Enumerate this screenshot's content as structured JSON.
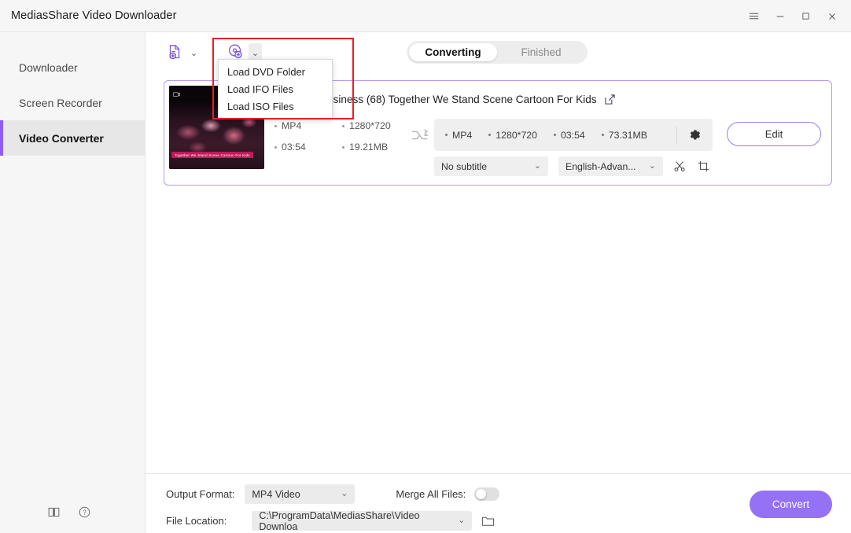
{
  "window": {
    "title": "MediasShare Video Downloader",
    "controls": [
      {
        "name": "menu-icon",
        "glyph": "☰"
      },
      {
        "name": "minimize-icon",
        "glyph": "—"
      },
      {
        "name": "maximize-icon",
        "glyph": "☐"
      },
      {
        "name": "close-icon",
        "glyph": "✕"
      }
    ]
  },
  "sidebar": {
    "items": [
      {
        "label": "Downloader",
        "active": false
      },
      {
        "label": "Screen Recorder",
        "active": false
      },
      {
        "label": "Video Converter",
        "active": true
      }
    ],
    "footer_icons": [
      {
        "name": "manual-book-icon"
      },
      {
        "name": "help-icon"
      }
    ]
  },
  "toolbar": {
    "add_file_label": "Add Files",
    "add_disc_label": "Load Disc",
    "caret": "⌄"
  },
  "tabs": [
    {
      "label": "Converting",
      "active": true
    },
    {
      "label": "Finished",
      "active": false
    }
  ],
  "dropdown_menu": {
    "visible": true,
    "items": [
      "Load DVD Folder",
      "Load IFO Files",
      "Load ISO Files"
    ]
  },
  "task": {
    "title": "by Family Business (68)  Together We Stand Scene  Cartoon For Kids",
    "thumbnail_caption": "Together We Stand Scene Cartoon For Kids",
    "source": {
      "format": "MP4",
      "resolution": "1280*720",
      "duration": "03:54",
      "size": "19.21MB"
    },
    "output": {
      "format": "MP4",
      "resolution": "1280*720",
      "duration": "03:54",
      "size": "73.31MB"
    },
    "subtitle_select": "No subtitle",
    "audio_select": "English-Advan...",
    "edit_button": "Edit"
  },
  "bottom": {
    "output_format_label": "Output Format:",
    "output_format_value": "MP4 Video",
    "merge_label": "Merge All Files:",
    "merge_enabled": false,
    "file_location_label": "File Location:",
    "file_location_value": "C:\\ProgramData\\MediasShare\\Video Downloa",
    "convert_button": "Convert"
  },
  "colors": {
    "accent": "#8b5cf6",
    "convert": "#9571f6",
    "card_border": "#b69bf0",
    "annotation": "#ec1c24"
  }
}
